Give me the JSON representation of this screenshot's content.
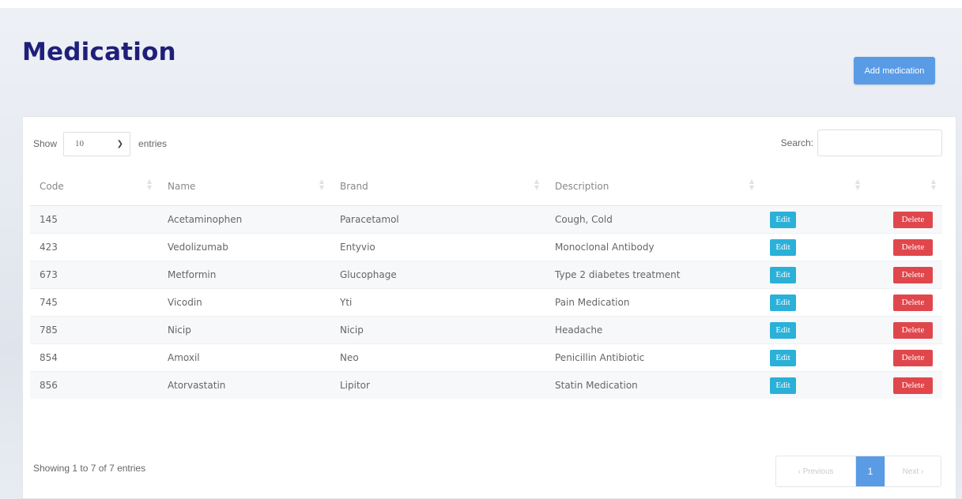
{
  "header": {
    "title": "Medication",
    "add_button": "Add medication"
  },
  "controls": {
    "show_label": "Show",
    "entries_value": "10",
    "entries_label": "entries",
    "search_label": "Search:",
    "search_value": ""
  },
  "table": {
    "columns": [
      "Code",
      "Name",
      "Brand",
      "Description",
      "",
      ""
    ],
    "rows": [
      {
        "code": "145",
        "name": "Acetaminophen",
        "brand": "Paracetamol",
        "description": "Cough, Cold"
      },
      {
        "code": "423",
        "name": "Vedolizumab",
        "brand": "Entyvio",
        "description": "Monoclonal Antibody"
      },
      {
        "code": "673",
        "name": "Metformin",
        "brand": "Glucophage",
        "description": "Type 2 diabetes treatment"
      },
      {
        "code": "745",
        "name": "Vicodin",
        "brand": "Yti",
        "description": "Pain Medication"
      },
      {
        "code": "785",
        "name": "Nicip",
        "brand": "Nicip",
        "description": "Headache"
      },
      {
        "code": "854",
        "name": "Amoxil",
        "brand": "Neo",
        "description": "Penicillin Antibiotic"
      },
      {
        "code": "856",
        "name": "Atorvastatin",
        "brand": "Lipitor",
        "description": "Statin Medication"
      }
    ],
    "edit_label": "Edit",
    "delete_label": "Delete"
  },
  "footer": {
    "info": "Showing 1 to 7 of 7 entries",
    "prev": "‹ Previous",
    "current_page": "1",
    "next": "Next ›"
  },
  "colors": {
    "title": "#1f1f7a",
    "primary": "#5a9be6",
    "edit": "#2bb0d8",
    "delete": "#e0474c"
  }
}
